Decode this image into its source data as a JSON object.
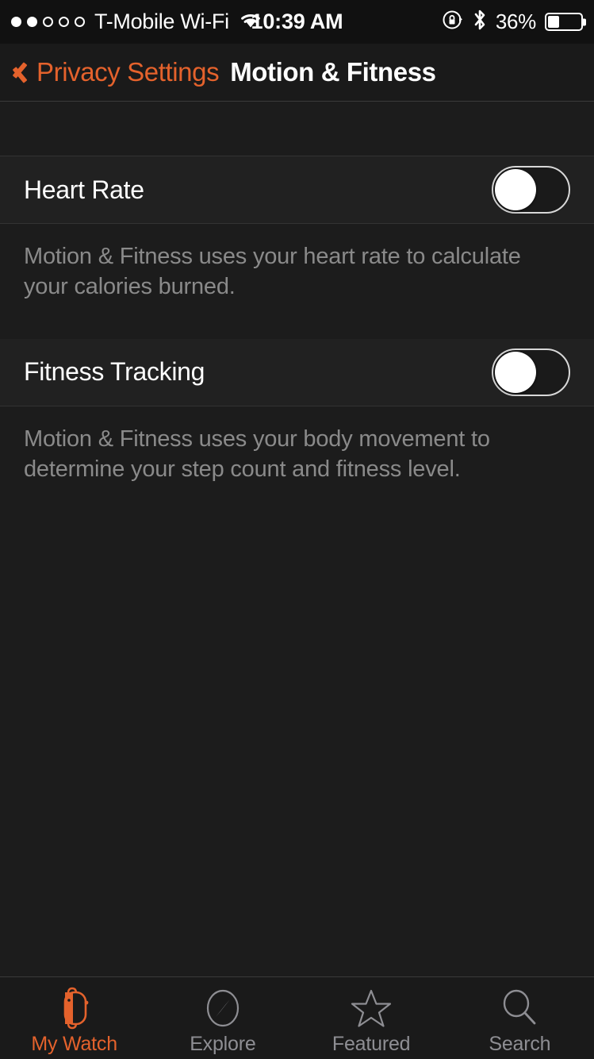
{
  "status_bar": {
    "signal_dots_filled": 2,
    "signal_dots_total": 5,
    "carrier": "T-Mobile Wi-Fi",
    "wifi_icon": "wifi-icon",
    "time": "10:39 AM",
    "rotation_lock_icon": "rotation-lock-icon",
    "bluetooth_icon": "bluetooth-icon",
    "battery_percent": "36%",
    "battery_level": 36
  },
  "nav_bar": {
    "back_icon": "chevron-left-icon",
    "back_label": "Privacy Settings",
    "title": "Motion & Fitness"
  },
  "settings": {
    "rows": [
      {
        "label": "Heart Rate",
        "toggle_state": "off",
        "footer": "Motion & Fitness uses your heart rate to calculate your calories burned."
      },
      {
        "label": "Fitness Tracking",
        "toggle_state": "off",
        "footer": "Motion & Fitness uses your body movement to determine your step count and fitness level."
      }
    ]
  },
  "tab_bar": {
    "active_index": 0,
    "tabs": [
      {
        "label": "My Watch",
        "icon": "apple-watch-icon"
      },
      {
        "label": "Explore",
        "icon": "compass-icon"
      },
      {
        "label": "Featured",
        "icon": "star-icon"
      },
      {
        "label": "Search",
        "icon": "magnifier-icon"
      }
    ]
  },
  "colors": {
    "accent": "#e4622c",
    "background": "#1c1c1c",
    "cell_background": "#212121",
    "separator": "#333333",
    "secondary_text": "#8a8a8a",
    "tab_inactive": "#8e8e93"
  }
}
